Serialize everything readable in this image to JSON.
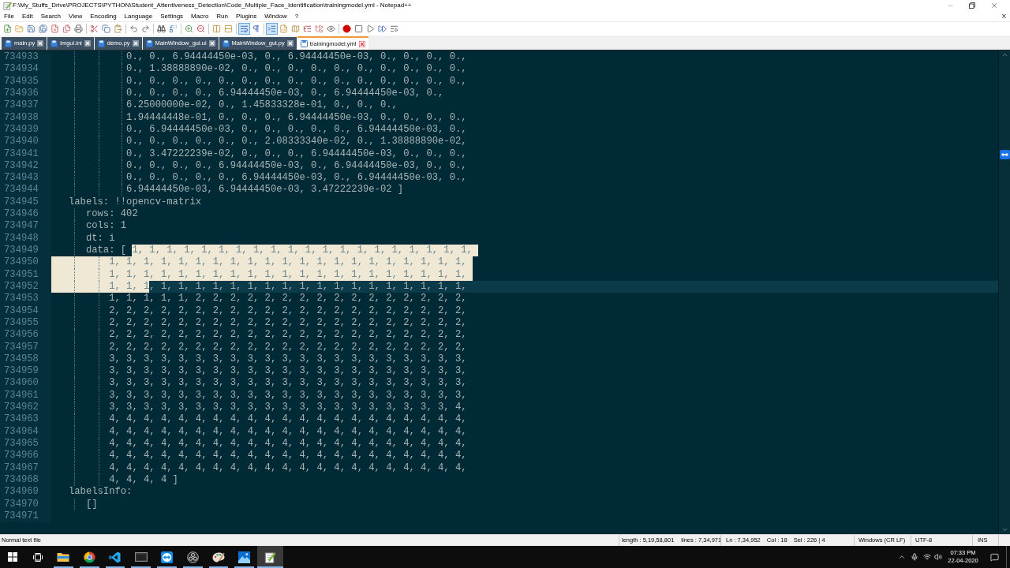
{
  "window": {
    "title": "F:\\My_Stuffs_Drive\\PROJECTS\\PYTHON\\Student_Attentiveness_Detection\\Code_Multiple_Face_Identification\\trainingmodel.yml - Notepad++"
  },
  "menu": {
    "items": [
      "File",
      "Edit",
      "Search",
      "View",
      "Encoding",
      "Language",
      "Settings",
      "Macro",
      "Run",
      "Plugins",
      "Window",
      "?"
    ],
    "close_document": "X"
  },
  "toolbar": {
    "groups": [
      [
        {
          "pressed": false
        },
        {
          "pressed": false
        },
        {
          "pressed": false
        },
        {
          "pressed": false
        },
        {
          "pressed": false
        },
        {
          "pressed": false
        },
        {
          "pressed": false
        }
      ],
      [
        {
          "pressed": false
        },
        {
          "pressed": false
        },
        {
          "pressed": false
        }
      ],
      [
        {
          "pressed": false
        },
        {
          "pressed": false
        }
      ],
      [
        {
          "pressed": false
        },
        {
          "pressed": false
        }
      ],
      [
        {
          "pressed": false
        },
        {
          "pressed": false
        }
      ],
      [
        {
          "pressed": false
        },
        {
          "pressed": false
        }
      ],
      [
        {
          "pressed": true
        },
        {
          "pressed": false
        }
      ],
      [
        {
          "pressed": true
        },
        {
          "pressed": false
        },
        {
          "pressed": false
        },
        {
          "pressed": false
        },
        {
          "pressed": false
        },
        {
          "pressed": false
        }
      ],
      [
        {
          "pressed": false
        },
        {
          "pressed": false
        },
        {
          "pressed": false
        },
        {
          "pressed": false
        },
        {
          "pressed": false
        }
      ]
    ]
  },
  "tabs": [
    {
      "label": "main.py",
      "selected": false
    },
    {
      "label": "imgui.ini",
      "selected": false
    },
    {
      "label": "demo.py",
      "selected": false
    },
    {
      "label": "MainWindow_gui.ui",
      "selected": false
    },
    {
      "label": "MainWindow_gui.py",
      "selected": false
    },
    {
      "label": "trainingmodel.yml",
      "selected": true
    }
  ],
  "editor": {
    "lines": [
      {
        "number": "734933",
        "current": false,
        "segments": [
          {
            "text": "             0., 0., 6.94444450e-03, 0., 6.94444450e-03, 0., 0., 0., 0.,",
            "selected": false
          }
        ]
      },
      {
        "number": "734934",
        "current": false,
        "segments": [
          {
            "text": "             0., 1.38888890e-02, 0., 0., 0., 0., 0., 0., 0., 0., 0., 0.,",
            "selected": false
          }
        ]
      },
      {
        "number": "734935",
        "current": false,
        "segments": [
          {
            "text": "             0., 0., 0., 0., 0., 0., 0., 0., 0., 0., 0., 0., 0., 0., 0.,",
            "selected": false
          }
        ]
      },
      {
        "number": "734936",
        "current": false,
        "segments": [
          {
            "text": "             0., 0., 0., 0., 6.94444450e-03, 0., 6.94444450e-03, 0.,",
            "selected": false
          }
        ]
      },
      {
        "number": "734937",
        "current": false,
        "segments": [
          {
            "text": "             6.25000000e-02, 0., 1.45833328e-01, 0., 0., 0.,",
            "selected": false
          }
        ]
      },
      {
        "number": "734938",
        "current": false,
        "segments": [
          {
            "text": "             1.94444448e-01, 0., 0., 0., 6.94444450e-03, 0., 0., 0., 0.,",
            "selected": false
          }
        ]
      },
      {
        "number": "734939",
        "current": false,
        "segments": [
          {
            "text": "             0., 6.94444450e-03, 0., 0., 0., 0., 0., 6.94444450e-03, 0.,",
            "selected": false
          }
        ]
      },
      {
        "number": "734940",
        "current": false,
        "segments": [
          {
            "text": "             0., 0., 0., 0., 0., 0., 2.08333340e-02, 0., 1.38888890e-02,",
            "selected": false
          }
        ]
      },
      {
        "number": "734941",
        "current": false,
        "segments": [
          {
            "text": "             0., 3.47222239e-02, 0., 0., 0., 6.94444450e-03, 0., 0., 0.,",
            "selected": false
          }
        ]
      },
      {
        "number": "734942",
        "current": false,
        "segments": [
          {
            "text": "             0., 0., 0., 0., 6.94444450e-03, 0., 6.94444450e-03, 0., 0.,",
            "selected": false
          }
        ]
      },
      {
        "number": "734943",
        "current": false,
        "segments": [
          {
            "text": "             0., 0., 0., 0., 0., 6.94444450e-03, 0., 6.94444450e-03, 0.,",
            "selected": false
          }
        ]
      },
      {
        "number": "734944",
        "current": false,
        "segments": [
          {
            "text": "             6.94444450e-03, 6.94444450e-03, 3.47222239e-02 ]",
            "selected": false
          }
        ]
      },
      {
        "number": "734945",
        "current": false,
        "segments": [
          {
            "text": "   labels: !!opencv-matrix",
            "selected": false
          }
        ]
      },
      {
        "number": "734946",
        "current": false,
        "segments": [
          {
            "text": "      rows: 402",
            "selected": false
          }
        ]
      },
      {
        "number": "734947",
        "current": false,
        "segments": [
          {
            "text": "      cols: 1",
            "selected": false
          }
        ]
      },
      {
        "number": "734948",
        "current": false,
        "segments": [
          {
            "text": "      dt: i",
            "selected": false
          }
        ]
      },
      {
        "number": "734949",
        "current": false,
        "segments": [
          {
            "text": "      data: [ ",
            "selected": false
          },
          {
            "text": "1, 1, 1, 1, 1, 1, 1, 1, 1, 1, 1, 1, 1, 1, 1, 1, 1, 1, 1, 1,",
            "selected": true
          }
        ]
      },
      {
        "number": "734950",
        "current": false,
        "segments": [
          {
            "text": "          1, 1, 1, 1, 1, 1, 1, 1, 1, 1, 1, 1, 1, 1, 1, 1, 1, 1, 1, 1, 1,",
            "selected": true
          }
        ]
      },
      {
        "number": "734951",
        "current": false,
        "segments": [
          {
            "text": "          1, 1, 1, 1, 1, 1, 1, 1, 1, 1, 1, 1, 1, 1, 1, 1, 1, 1, 1, 1, 1,",
            "selected": true
          }
        ]
      },
      {
        "number": "734952",
        "current": true,
        "segments": [
          {
            "text": "          1, 1, 1",
            "selected": true
          },
          {
            "text": ", 1, 1, 1, 1, 1, 1, 1, 1, 1, 1, 1, 1, 1, 1, 1, 1, 1, 1,",
            "selected": false
          }
        ]
      },
      {
        "number": "734953",
        "current": false,
        "segments": [
          {
            "text": "          1, 1, 1, 1, 1, 2, 2, 2, 2, 2, 2, 2, 2, 2, 2, 2, 2, 2, 2, 2, 2,",
            "selected": false
          }
        ]
      },
      {
        "number": "734954",
        "current": false,
        "segments": [
          {
            "text": "          2, 2, 2, 2, 2, 2, 2, 2, 2, 2, 2, 2, 2, 2, 2, 2, 2, 2, 2, 2, 2,",
            "selected": false
          }
        ]
      },
      {
        "number": "734955",
        "current": false,
        "segments": [
          {
            "text": "          2, 2, 2, 2, 2, 2, 2, 2, 2, 2, 2, 2, 2, 2, 2, 2, 2, 2, 2, 2, 2,",
            "selected": false
          }
        ]
      },
      {
        "number": "734956",
        "current": false,
        "segments": [
          {
            "text": "          2, 2, 2, 2, 2, 2, 2, 2, 2, 2, 2, 2, 2, 2, 2, 2, 2, 2, 2, 2, 2,",
            "selected": false
          }
        ]
      },
      {
        "number": "734957",
        "current": false,
        "segments": [
          {
            "text": "          2, 2, 2, 2, 2, 2, 2, 2, 2, 2, 2, 2, 2, 2, 2, 2, 2, 2, 2, 2, 2,",
            "selected": false
          }
        ]
      },
      {
        "number": "734958",
        "current": false,
        "segments": [
          {
            "text": "          3, 3, 3, 3, 3, 3, 3, 3, 3, 3, 3, 3, 3, 3, 3, 3, 3, 3, 3, 3, 3,",
            "selected": false
          }
        ]
      },
      {
        "number": "734959",
        "current": false,
        "segments": [
          {
            "text": "          3, 3, 3, 3, 3, 3, 3, 3, 3, 3, 3, 3, 3, 3, 3, 3, 3, 3, 3, 3, 3,",
            "selected": false
          }
        ]
      },
      {
        "number": "734960",
        "current": false,
        "segments": [
          {
            "text": "          3, 3, 3, 3, 3, 3, 3, 3, 3, 3, 3, 3, 3, 3, 3, 3, 3, 3, 3, 3, 3,",
            "selected": false
          }
        ]
      },
      {
        "number": "734961",
        "current": false,
        "segments": [
          {
            "text": "          3, 3, 3, 3, 3, 3, 3, 3, 3, 3, 3, 3, 3, 3, 3, 3, 3, 3, 3, 3, 3,",
            "selected": false
          }
        ]
      },
      {
        "number": "734962",
        "current": false,
        "segments": [
          {
            "text": "          3, 3, 3, 3, 3, 3, 3, 3, 3, 3, 3, 3, 3, 3, 3, 3, 3, 3, 3, 3, 4,",
            "selected": false
          }
        ]
      },
      {
        "number": "734963",
        "current": false,
        "segments": [
          {
            "text": "          4, 4, 4, 4, 4, 4, 4, 4, 4, 4, 4, 4, 4, 4, 4, 4, 4, 4, 4, 4, 4,",
            "selected": false
          }
        ]
      },
      {
        "number": "734964",
        "current": false,
        "segments": [
          {
            "text": "          4, 4, 4, 4, 4, 4, 4, 4, 4, 4, 4, 4, 4, 4, 4, 4, 4, 4, 4, 4, 4,",
            "selected": false
          }
        ]
      },
      {
        "number": "734965",
        "current": false,
        "segments": [
          {
            "text": "          4, 4, 4, 4, 4, 4, 4, 4, 4, 4, 4, 4, 4, 4, 4, 4, 4, 4, 4, 4, 4,",
            "selected": false
          }
        ]
      },
      {
        "number": "734966",
        "current": false,
        "segments": [
          {
            "text": "          4, 4, 4, 4, 4, 4, 4, 4, 4, 4, 4, 4, 4, 4, 4, 4, 4, 4, 4, 4, 4,",
            "selected": false
          }
        ]
      },
      {
        "number": "734967",
        "current": false,
        "segments": [
          {
            "text": "          4, 4, 4, 4, 4, 4, 4, 4, 4, 4, 4, 4, 4, 4, 4, 4, 4, 4, 4, 4, 4,",
            "selected": false
          }
        ]
      },
      {
        "number": "734968",
        "current": false,
        "segments": [
          {
            "text": "          4, 4, 4, 4 ]",
            "selected": false
          }
        ]
      },
      {
        "number": "734969",
        "current": false,
        "segments": [
          {
            "text": "   labelsInfo:",
            "selected": false
          }
        ]
      },
      {
        "number": "734970",
        "current": false,
        "segments": [
          {
            "text": "      []",
            "selected": false
          }
        ]
      },
      {
        "number": "734971",
        "current": false
      }
    ]
  },
  "status_bar": {
    "file_type": "Normal text file",
    "length": "length : 5,19,58,801",
    "lines": "lines : 7,34,971",
    "line": "Ln : 7,34,952",
    "column": "Col : 18",
    "selection": "Sel : 226 | 4",
    "eol": "Windows (CR LF)",
    "encoding": "UTF-8",
    "mode": "INS"
  },
  "taskbar": {
    "apps": [
      {
        "running": true,
        "selected": false
      },
      {
        "running": true,
        "selected": false
      },
      {
        "running": true,
        "selected": false
      },
      {
        "running": true,
        "selected": false
      },
      {
        "running": true,
        "selected": false
      },
      {
        "running": true,
        "selected": false
      },
      {
        "running": true,
        "selected": false
      },
      {
        "running": true,
        "selected": false
      },
      {
        "running": true,
        "selected": true
      }
    ],
    "clock": {
      "time": "07:33 PM",
      "date": "22-04-2020"
    }
  }
}
